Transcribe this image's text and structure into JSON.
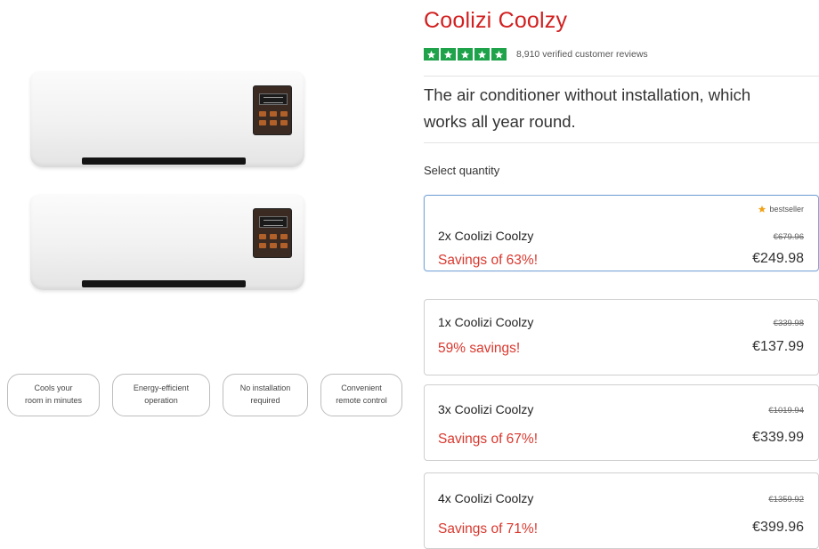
{
  "product": {
    "title": "Coolizi Coolzy",
    "rating": {
      "stars": 5,
      "reviews_text": "8,910 verified customer reviews",
      "star_color": "#1fa34a"
    },
    "subtitle": "The air conditioner without installation, which\nworks all year round."
  },
  "features": [
    {
      "label": "Cools your\nroom in minutes"
    },
    {
      "label": "Energy-efficient\noperation"
    },
    {
      "label": "No installation\nrequired"
    },
    {
      "label": "Convenient\nremote control"
    }
  ],
  "quantity": {
    "label": "Select quantity",
    "options": [
      {
        "name": "2x Coolizi Coolzy",
        "savings": "Savings of 63%!",
        "old_price": "€679.96",
        "price": "€249.98",
        "badge": "bestseller",
        "selected": true
      },
      {
        "name": "1x Coolizi Coolzy",
        "savings": "59% savings!",
        "old_price": "€339.98",
        "price": "€137.99",
        "badge": "",
        "selected": false
      },
      {
        "name": "3x Coolizi Coolzy",
        "savings": "Savings of 67%!",
        "old_price": "€1019.94",
        "price": "€339.99",
        "badge": "",
        "selected": false
      },
      {
        "name": "4x Coolizi Coolzy",
        "savings": "Savings of 71%!",
        "old_price": "€1359.92",
        "price": "€399.96",
        "badge": "",
        "selected": false
      }
    ]
  },
  "colors": {
    "brand_red": "#d21f1f",
    "savings_red": "#d9382e",
    "selected_border": "#7da7d9",
    "badge_star": "#f0a21a"
  }
}
